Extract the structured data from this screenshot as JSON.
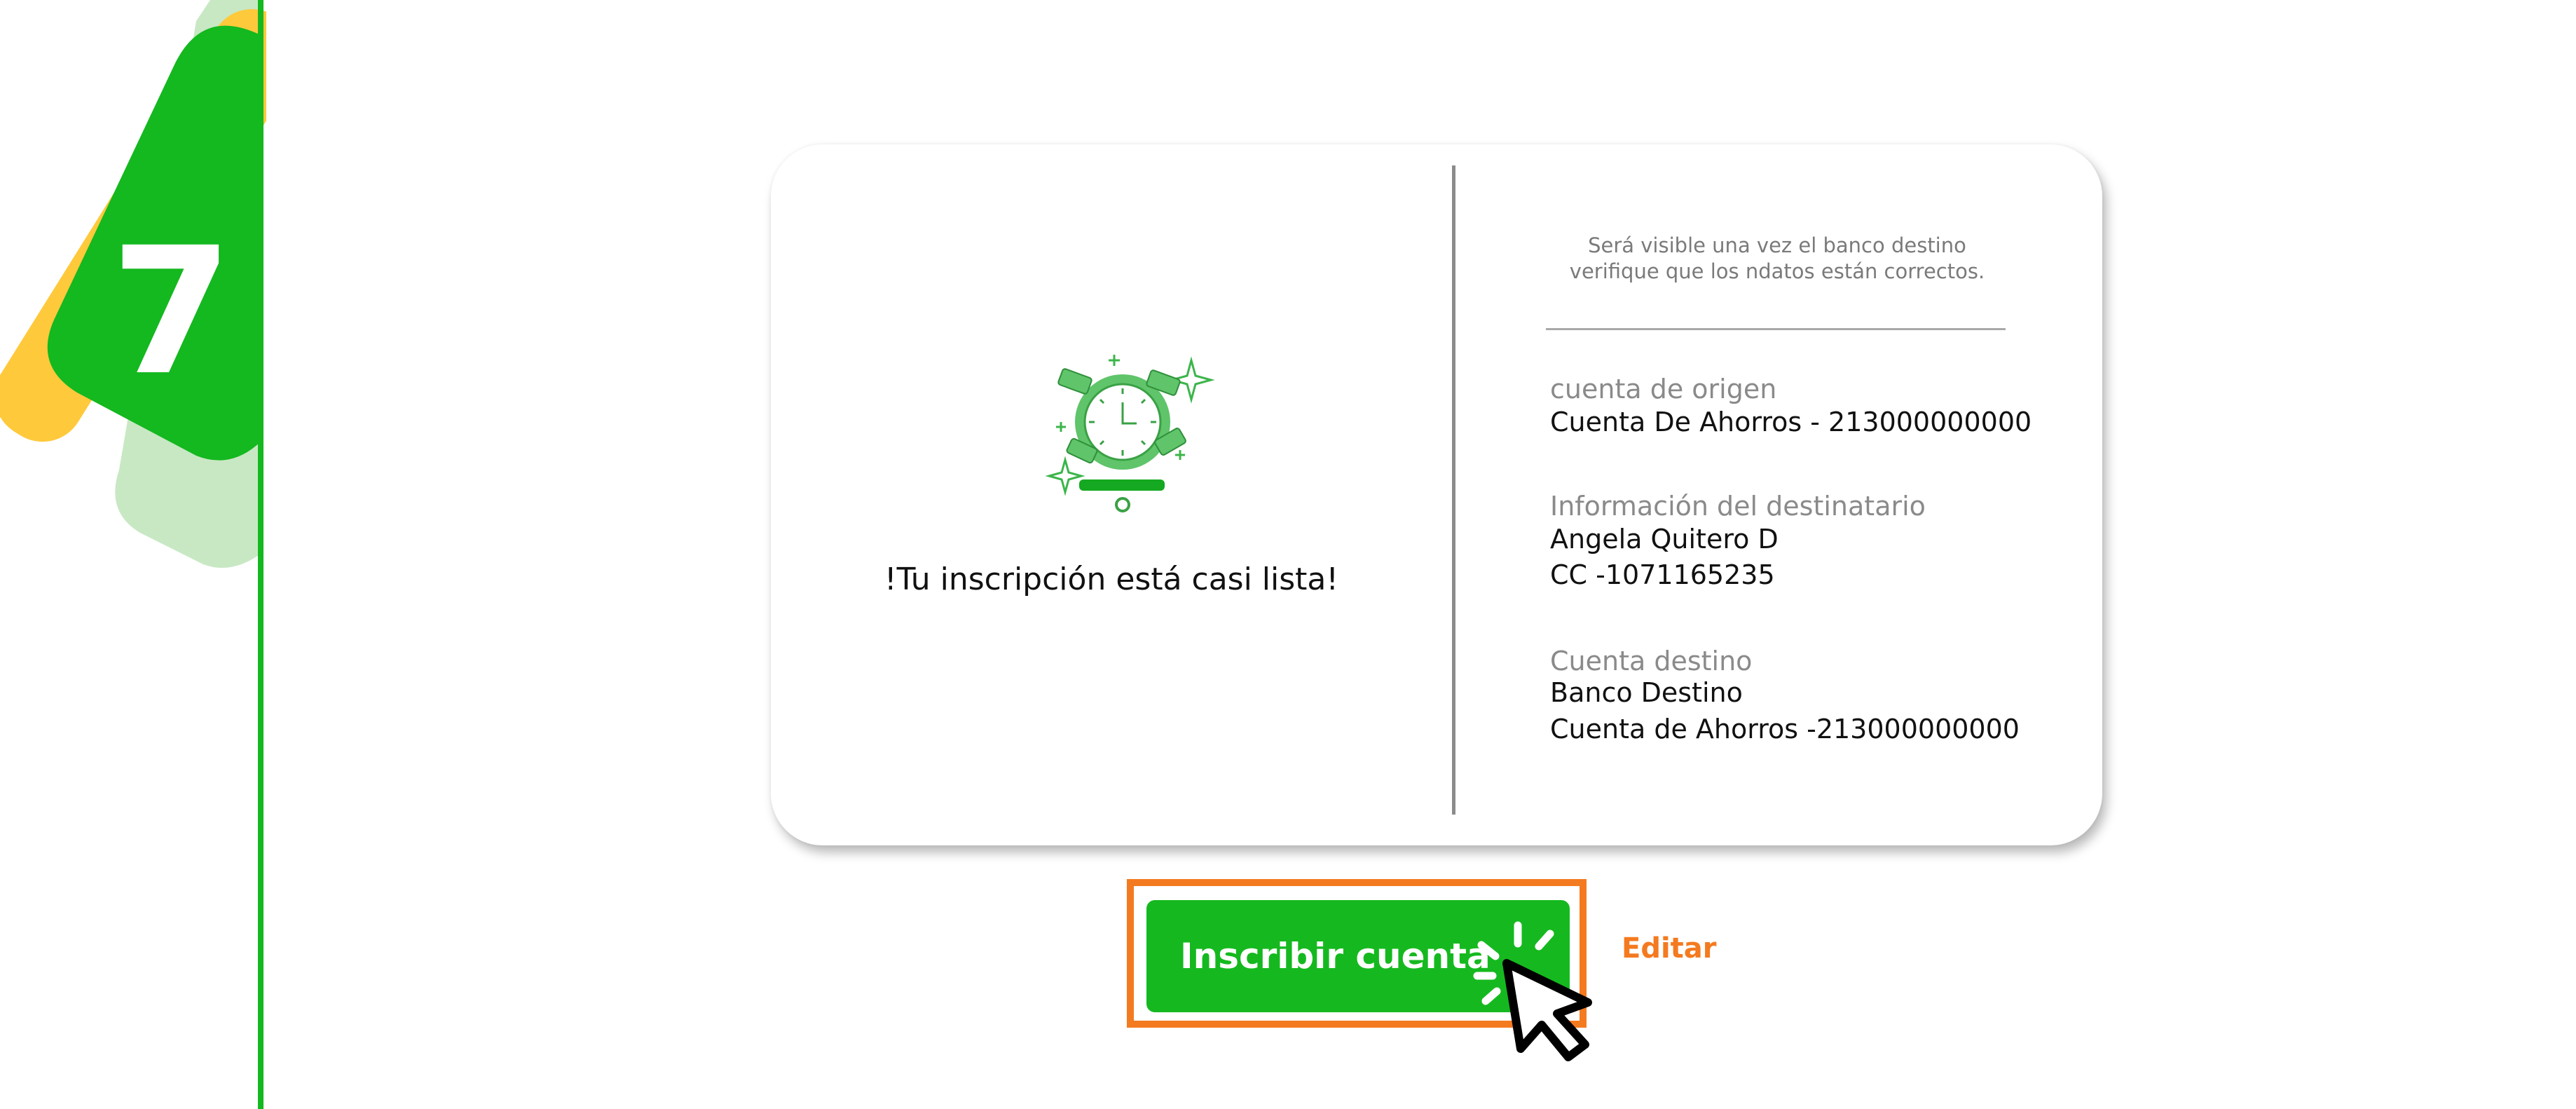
{
  "step": {
    "number": "7"
  },
  "status": {
    "icon": "money-clock-icon",
    "message": "!Tu inscripción está casi lista!"
  },
  "notice": "Será visible una vez el banco destino verifique que los ndatos están correctos.",
  "origin": {
    "label": "cuenta de origen",
    "value": "Cuenta De Ahorros - 213000000000"
  },
  "recipient": {
    "label": "Información del destinatario",
    "name": "Angela Quitero D",
    "document": "CC -1071165235"
  },
  "destination": {
    "label": "Cuenta destino",
    "bank": "Banco Destino",
    "account": "Cuenta de Ahorros -213000000000"
  },
  "actions": {
    "submit_label": "Inscribir cuenta",
    "edit_label": "Editar"
  },
  "colors": {
    "brand_green": "#14b81f",
    "accent_orange": "#f47a20",
    "badge_yellow": "#ffc93c",
    "light_green": "#c8e8c4"
  }
}
